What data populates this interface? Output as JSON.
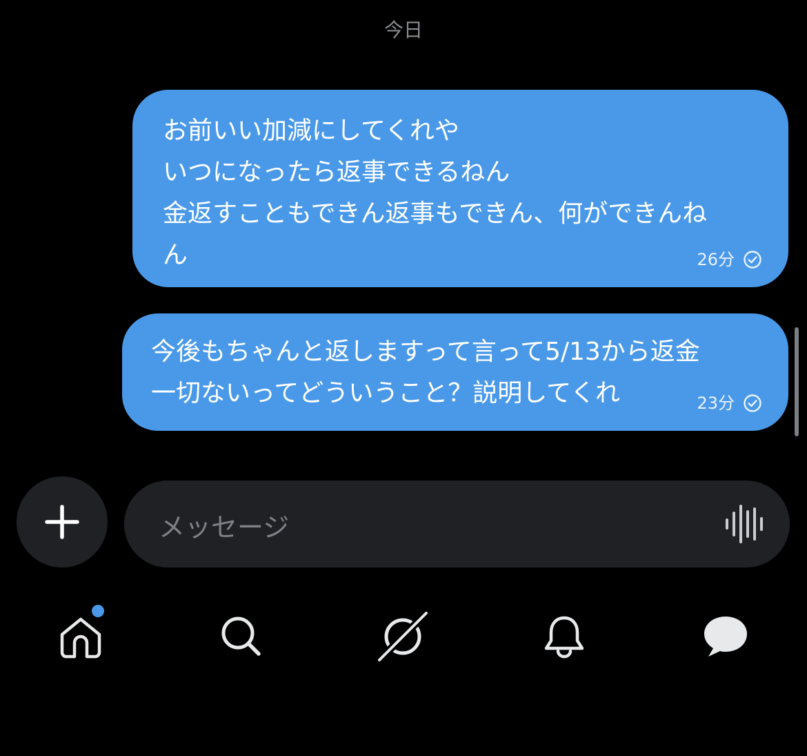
{
  "date_separator": "今日",
  "messages": [
    {
      "lines": [
        "お前いい加減にしてくれや",
        "いつになったら返事できるねん",
        "金返すこともできん返事もできん、何ができんね",
        "ん"
      ],
      "time": "26分",
      "status_icon": "read-check-icon"
    },
    {
      "lines": [
        "今後もちゃんと返しますって言って5/13から返金",
        "一切ないってどういうこと？説明してくれ"
      ],
      "time": "23分",
      "status_icon": "read-check-icon"
    }
  ],
  "composer": {
    "placeholder": "メッセージ",
    "add_icon": "plus-icon",
    "voice_icon": "voice-waveform-icon"
  },
  "tabbar": {
    "items": [
      {
        "icon": "home-icon",
        "has_badge": true
      },
      {
        "icon": "search-icon"
      },
      {
        "icon": "grok-icon"
      },
      {
        "icon": "bell-icon"
      },
      {
        "icon": "messages-icon"
      }
    ]
  },
  "colors": {
    "bubble": "#4a99e9",
    "background": "#000000",
    "composer_bg": "#202124",
    "muted_text": "#8a8d91"
  }
}
